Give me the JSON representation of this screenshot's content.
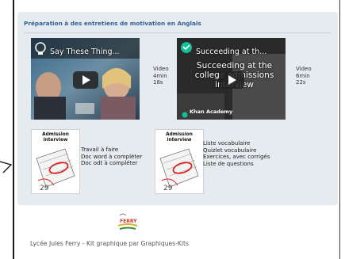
{
  "section": {
    "title": "Préparation à des entretiens de motivation en Anglais"
  },
  "videos": [
    {
      "overlay_title": "Say These Thing...",
      "overlay_subtitle": "",
      "channel": "",
      "info": [
        "Video",
        "4min",
        "18s"
      ]
    },
    {
      "overlay_title": "Succeeding at th...",
      "overlay_subtitle": "Succeeding at the college admissions interview",
      "channel": "Khan Academy",
      "info": [
        "Video",
        "6min",
        "22s"
      ]
    }
  ],
  "resources": [
    {
      "thumb_label": [
        "Admission",
        "interview"
      ],
      "items": [
        "Travail à faire",
        "Doc word à compléter",
        "Doc odt à compléter"
      ]
    },
    {
      "thumb_label": [
        "Admission",
        "interview"
      ],
      "items": [
        "Liste vocabulaire",
        "Quizlet vocabulaire",
        "Exercices, avec corrigés",
        "Liste de questions"
      ]
    }
  ],
  "footer": {
    "logo_text": "FERRY",
    "text": "Lycée Jules Ferry - Kit graphique par Graphiques-Kits"
  },
  "colors": {
    "panel_bg": "#e6ebf0",
    "title": "#2e5f96",
    "khan_green": "#14bf96"
  }
}
